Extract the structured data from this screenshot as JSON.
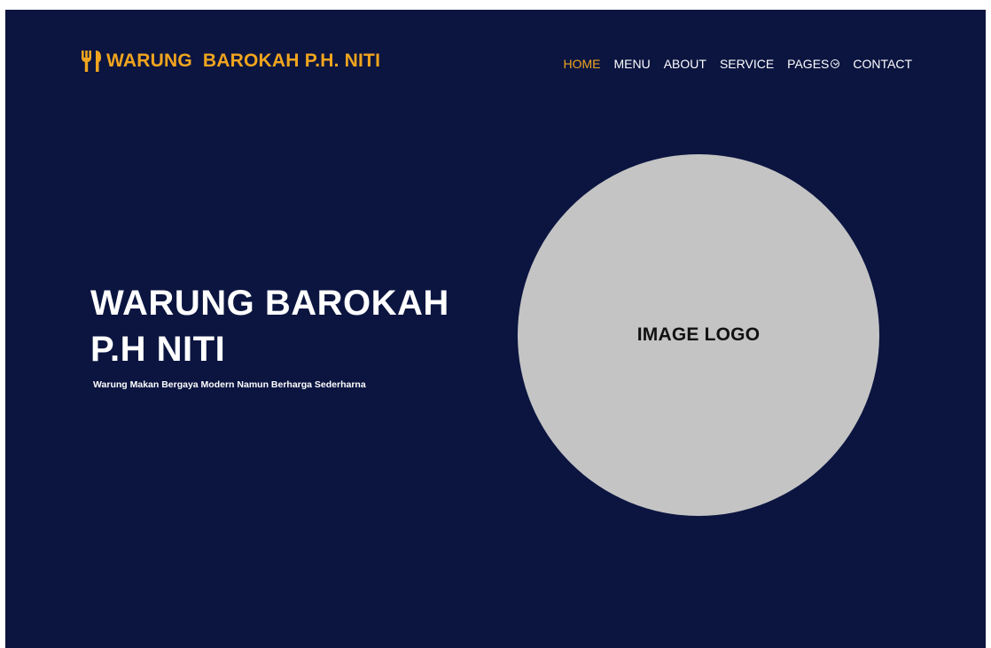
{
  "brand": {
    "name": "WARUNG  BAROKAH P.H. NITI",
    "icon": "fork-spoon-icon"
  },
  "nav": {
    "items": [
      {
        "label": "HOME",
        "active": true
      },
      {
        "label": "MENU",
        "active": false
      },
      {
        "label": "ABOUT",
        "active": false
      },
      {
        "label": "SERVICE",
        "active": false
      },
      {
        "label": "PAGES",
        "active": false,
        "icon": "chevron-down-icon"
      },
      {
        "label": "CONTACT",
        "active": false
      }
    ]
  },
  "hero": {
    "title_line1": "WARUNG BAROKAH",
    "title_line2": "P.H NITI",
    "subtitle": "Warung Makan Bergaya Modern Namun Berharga Sederharna"
  },
  "logo_placeholder": {
    "label": "IMAGE LOGO"
  },
  "colors": {
    "background": "#0b1540",
    "accent": "#f0a51e",
    "text": "#ffffff",
    "placeholder": "#c4c4c4"
  }
}
